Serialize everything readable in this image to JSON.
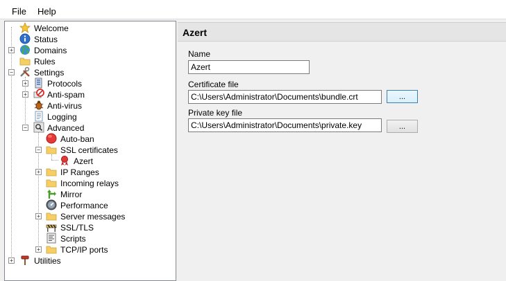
{
  "menu": {
    "file": "File",
    "help": "Help"
  },
  "tree": {
    "welcome": "Welcome",
    "status": "Status",
    "domains": "Domains",
    "rules": "Rules",
    "settings": "Settings",
    "protocols": "Protocols",
    "antispam": "Anti-spam",
    "antivirus": "Anti-virus",
    "logging": "Logging",
    "advanced": "Advanced",
    "autoban": "Auto-ban",
    "ssl_certificates": "SSL certificates",
    "azert": "Azert",
    "ip_ranges": "IP Ranges",
    "incoming_relays": "Incoming relays",
    "mirror": "Mirror",
    "performance": "Performance",
    "server_messages": "Server messages",
    "ssl_tls": "SSL/TLS",
    "scripts": "Scripts",
    "tcpip_ports": "TCP/IP ports",
    "utilities": "Utilities",
    "expand_symbol": "+",
    "collapse_symbol": "−"
  },
  "panel": {
    "title": "Azert",
    "name_label": "Name",
    "name_value": "Azert",
    "cert_label": "Certificate file",
    "cert_value": "C:\\Users\\Administrator\\Documents\\bundle.crt",
    "key_label": "Private key file",
    "key_value": "C:\\Users\\Administrator\\Documents\\private.key",
    "browse_label": "..."
  },
  "colors": {
    "folder": "#f5cf64",
    "selection_focus": "#3c7fb1",
    "panel_header": "#e5e5e5"
  }
}
